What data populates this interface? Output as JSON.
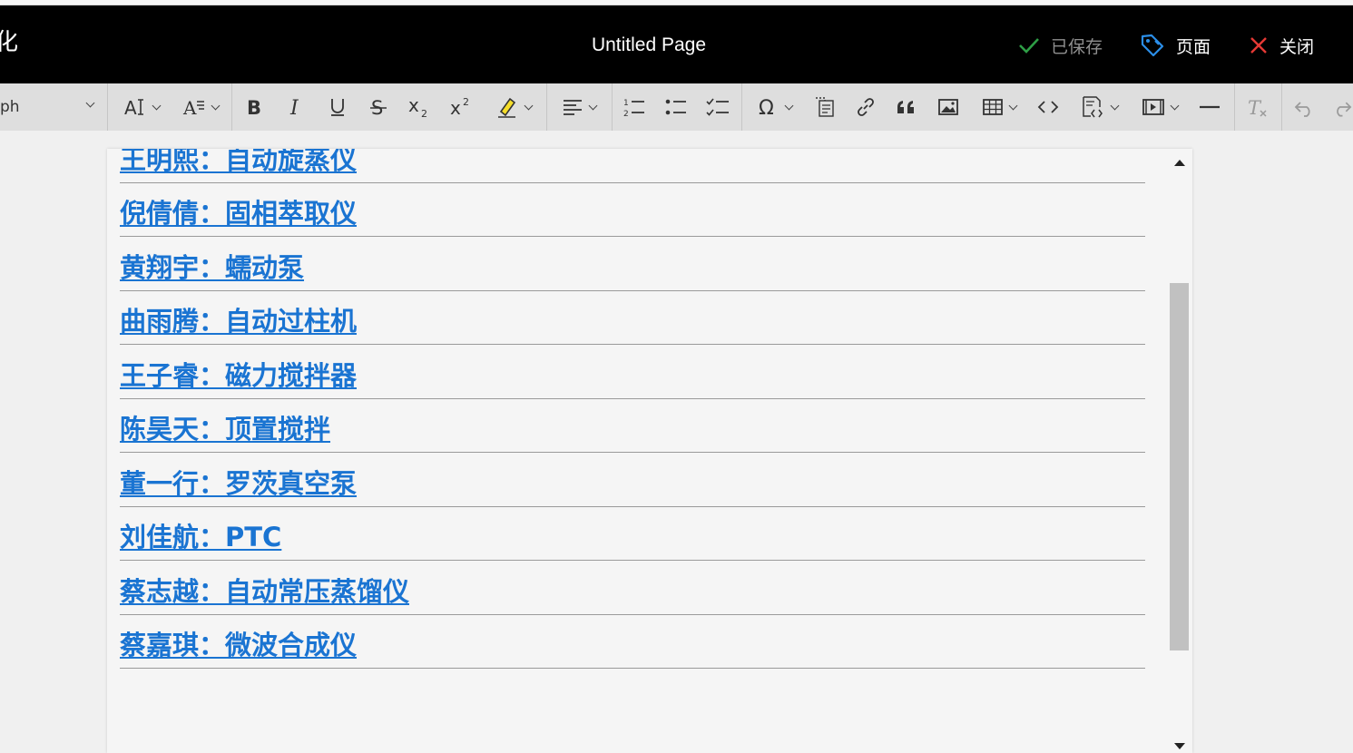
{
  "titlebar": {
    "left_glyph": "化",
    "title": "Untitled Page",
    "saved_label": "已保存",
    "page_label": "页面",
    "close_label": "关闭",
    "colors": {
      "saved_check": "#2e9e46",
      "page_icon": "#2b8ee8",
      "close_x": "#e53935"
    }
  },
  "toolbar": {
    "paragraph_value": "ph",
    "tools": [
      "font-size-icon",
      "font-family-icon",
      "bold-icon",
      "italic-icon",
      "underline-icon",
      "strikethrough-icon",
      "subscript-icon",
      "superscript-icon",
      "highlight-icon",
      "align-icon",
      "numbered-list-icon",
      "bulleted-list-icon",
      "todo-list-icon",
      "special-characters-icon",
      "paste-from-office-icon",
      "link-icon",
      "blockquote-icon",
      "image-icon",
      "table-icon",
      "code-icon",
      "source-editing-icon",
      "media-embed-icon",
      "horizontal-line-icon",
      "remove-format-icon",
      "undo-icon",
      "redo-icon"
    ]
  },
  "editor": {
    "links": [
      "王明熙：自动旋蒸仪",
      "倪倩倩：固相萃取仪",
      "黄翔宇：蠕动泵",
      "曲雨腾：自动过柱机",
      "王子睿：磁力搅拌器",
      "陈昊天：顶置搅拌",
      "董一行：罗茨真空泵",
      "刘佳航：PTC",
      "蔡志越：自动常压蒸馏仪",
      "蔡嘉琪：微波合成仪"
    ],
    "link_color": "#1a74d2"
  }
}
